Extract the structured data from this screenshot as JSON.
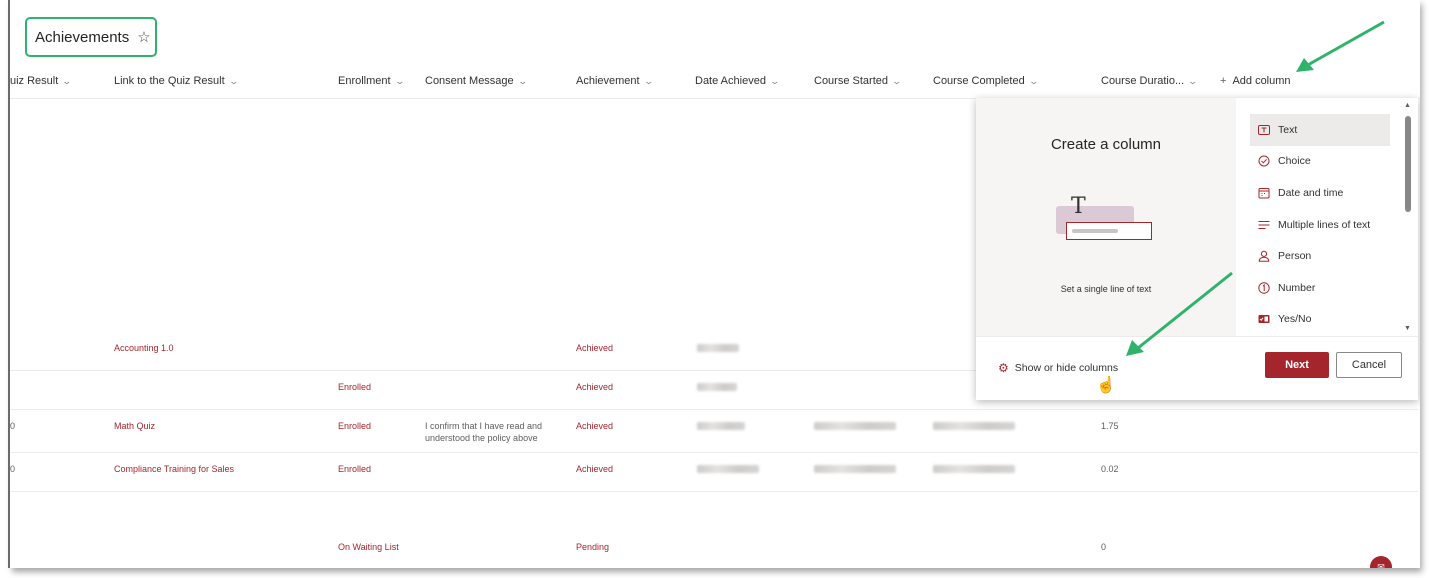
{
  "page": {
    "title": "Achievements",
    "favorite_icon": "star-icon"
  },
  "columns": [
    "uiz Result",
    "Link to the Quiz Result",
    "Enrollment",
    "Consent Message",
    "Achievement",
    "Date Achieved",
    "Course Started",
    "Course Completed",
    "Course Duratio..."
  ],
  "add_column": {
    "icon": "+",
    "label": "Add column"
  },
  "rows": [
    {
      "quiz_result": "",
      "link": "Accounting 1.0",
      "enrollment": "",
      "consent": "",
      "achievement": "Achieved",
      "duration": ""
    },
    {
      "quiz_result": "",
      "link": "",
      "enrollment": "Enrolled",
      "consent": "",
      "achievement": "Achieved",
      "duration": ""
    },
    {
      "quiz_result": "0",
      "link": "Math Quiz",
      "enrollment": "Enrolled",
      "consent": "I confirm that I have read and understood the policy above",
      "achievement": "Achieved",
      "duration": "1.75"
    },
    {
      "quiz_result": "0",
      "link": "Compliance Training for Sales",
      "enrollment": "Enrolled",
      "consent": "",
      "achievement": "Achieved",
      "duration": "0.02"
    },
    {
      "quiz_result": "",
      "link": "",
      "enrollment": "On Waiting List",
      "consent": "",
      "achievement": "Pending",
      "duration": "0"
    }
  ],
  "create_column_panel": {
    "title": "Create a column",
    "caption": "Set a single line of text",
    "types": [
      {
        "label": "Text",
        "icon": "text-icon",
        "selected": true
      },
      {
        "label": "Choice",
        "icon": "choice-icon"
      },
      {
        "label": "Date and time",
        "icon": "calendar-icon"
      },
      {
        "label": "Multiple lines of text",
        "icon": "multiline-icon"
      },
      {
        "label": "Person",
        "icon": "person-icon"
      },
      {
        "label": "Number",
        "icon": "number-icon"
      },
      {
        "label": "Yes/No",
        "icon": "yes-no-icon"
      }
    ],
    "show_hide_label": "Show or hide columns",
    "next_label": "Next",
    "cancel_label": "Cancel"
  },
  "colors": {
    "accent": "#a4262c",
    "highlight_border": "#2fb36a",
    "annotation_arrow": "#2fb36a"
  }
}
